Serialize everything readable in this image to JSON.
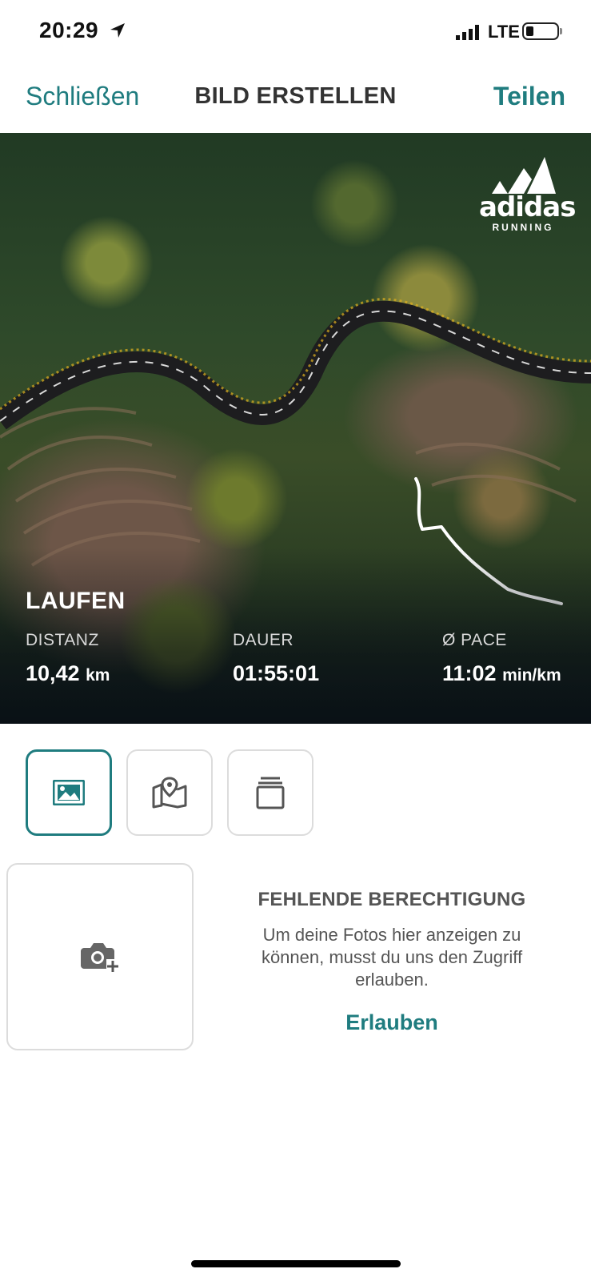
{
  "status_bar": {
    "time": "20:29",
    "network": "LTE",
    "icons": [
      "location-arrow-icon",
      "signal-icon",
      "battery-icon"
    ]
  },
  "nav": {
    "close_label": "Schließen",
    "title": "BILD ERSTELLEN",
    "share_label": "Teilen"
  },
  "preview": {
    "brand": {
      "name": "adidas",
      "sub": "RUNNING"
    },
    "activity_type": "LAUFEN",
    "stats": [
      {
        "label": "DISTANZ",
        "value": "10,42",
        "unit": "km"
      },
      {
        "label": "DAUER",
        "value": "01:55:01",
        "unit": ""
      },
      {
        "label": "Ø PACE",
        "value": "11:02",
        "unit": "min/km"
      }
    ]
  },
  "tiles": [
    {
      "name": "image-icon",
      "active": true
    },
    {
      "name": "map-icon",
      "active": false
    },
    {
      "name": "stack-icon",
      "active": false
    }
  ],
  "photos": {
    "add_icon": "camera-plus-icon",
    "permission_title": "FEHLENDE BERECHTIGUNG",
    "permission_text": "Um deine Fotos hier anzeigen zu können, musst du uns den Zugriff erlauben.",
    "allow_label": "Erlauben"
  },
  "colors": {
    "accent": "#1f7c7f",
    "border": "#dcdcdc",
    "muted_text": "#555555"
  }
}
